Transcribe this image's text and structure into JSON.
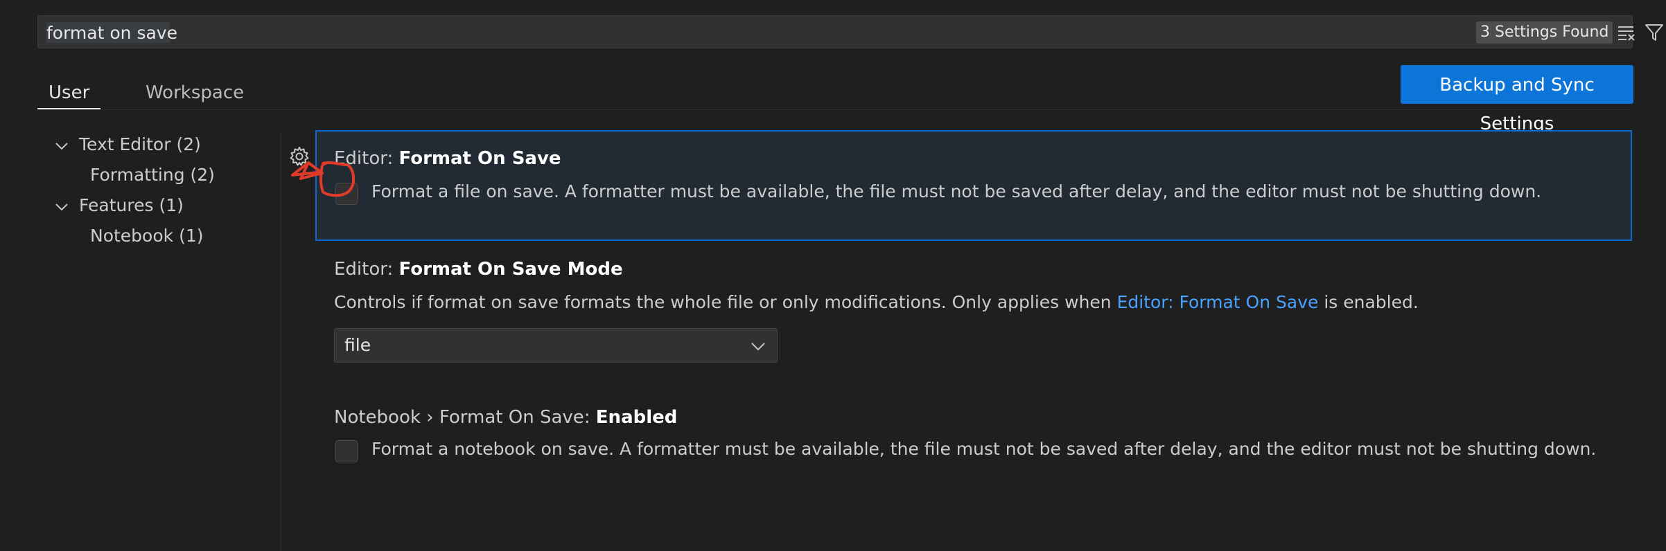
{
  "search": {
    "value": "format on save",
    "results_count": "3 Settings Found"
  },
  "tabs": [
    {
      "label": "User"
    },
    {
      "label": "Workspace"
    }
  ],
  "sync_button": {
    "label": "Backup and Sync Settings"
  },
  "toc": [
    {
      "label": "Text Editor (2)"
    },
    {
      "label": "Formatting (2)"
    },
    {
      "label": "Features (1)"
    },
    {
      "label": "Notebook (1)"
    }
  ],
  "settings": [
    {
      "category": "Editor: ",
      "name": "Format On Save",
      "description": "Format a file on save. A formatter must be available, the file must not be saved after delay, and the editor must not be shutting down.",
      "checked": false
    },
    {
      "category": "Editor: ",
      "name": "Format On Save Mode",
      "description_before": "Controls if format on save formats the whole file or only modifications. Only applies when ",
      "description_link": "Editor: Format On Save",
      "description_after": " is enabled.",
      "value": "file"
    },
    {
      "category": "Notebook › Format On Save: ",
      "name": "Enabled",
      "description": "Format a notebook on save. A formatter must be available, the file must not be saved after delay, and the editor must not be shutting down.",
      "checked": false
    }
  ],
  "colors": {
    "accent": "#0e75d8",
    "focus_border": "#0e6ad3",
    "link": "#4aa2ff",
    "annotation": "#e03a2a"
  }
}
